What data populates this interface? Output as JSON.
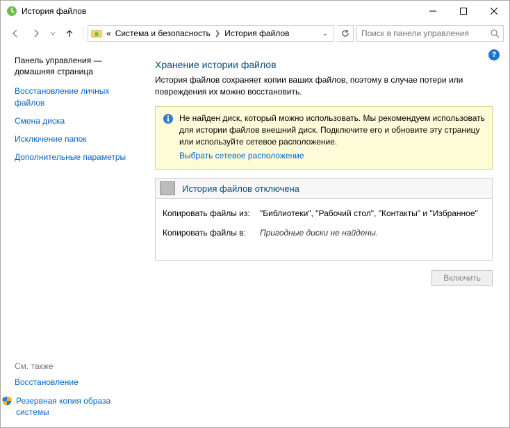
{
  "window": {
    "title": "История файлов"
  },
  "breadcrumb": {
    "prefix": "«",
    "items": [
      "Система и безопасность",
      "История файлов"
    ]
  },
  "search": {
    "placeholder": "Поиск в панели управления"
  },
  "sidebar": {
    "home": "Панель управления — домашняя страница",
    "links": [
      "Восстановление личных файлов",
      "Смена диска",
      "Исключение папок",
      "Дополнительные параметры"
    ],
    "see_also_label": "См. также",
    "see_also_links": [
      "Восстановление",
      "Резервная копия образа системы"
    ]
  },
  "content": {
    "title": "Хранение истории файлов",
    "description": "История файлов сохраняет копии ваших файлов, поэтому в случае потери или повреждения их можно восстановить.",
    "warning_text": "Не найден диск, который можно использовать. Мы рекомендуем использовать для истории файлов внешний диск. Подключите его и обновите эту страницу или используйте сетевое расположение.",
    "warning_link": "Выбрать сетевое расположение",
    "status_title": "История файлов отключена",
    "copy_from_label": "Копировать файлы из:",
    "copy_from_value": "\"Библиотеки\", \"Рабочий стол\", \"Контакты\" и \"Избранное\"",
    "copy_to_label": "Копировать файлы в:",
    "copy_to_value": "Пригодные диски не найдены.",
    "enable_button": "Включить"
  }
}
